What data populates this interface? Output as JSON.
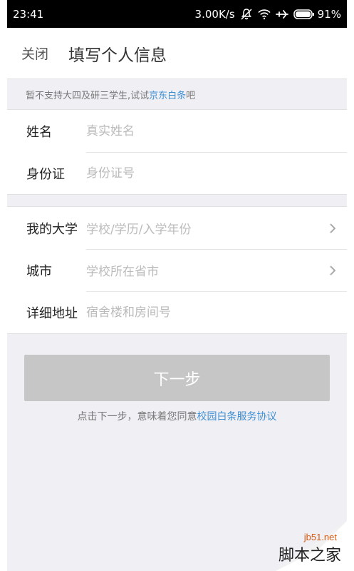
{
  "status_bar": {
    "time": "23:41",
    "speed": "3.00K/s",
    "battery": "91%",
    "icons": [
      "mute-icon",
      "wifi-icon",
      "airplane-icon",
      "battery-icon"
    ]
  },
  "nav": {
    "close_label": "关闭",
    "title": "填写个人信息"
  },
  "notice": {
    "text": "暂不支持大四及研三学生,试试",
    "link": "京东白条",
    "suffix": "吧"
  },
  "form": {
    "name": {
      "label": "姓名",
      "placeholder": "真实姓名"
    },
    "id_card": {
      "label": "身份证",
      "placeholder": "身份证号"
    },
    "university": {
      "label": "我的大学",
      "placeholder": "学校/学历/入学年份"
    },
    "city": {
      "label": "城市",
      "placeholder": "学校所在省市"
    },
    "address": {
      "label": "详细地址",
      "placeholder": "宿舍楼和房间号"
    }
  },
  "next_button": {
    "label": "下一步"
  },
  "agreement": {
    "text": "点击下一步，意味着您同意",
    "link": "校园白条服务协议"
  },
  "watermark": {
    "site": "jb51.net",
    "name": "脚本之家"
  },
  "colors": {
    "link": "#3f8fd3",
    "button_disabled": "#c6c6c6",
    "background": "#efeff4"
  }
}
